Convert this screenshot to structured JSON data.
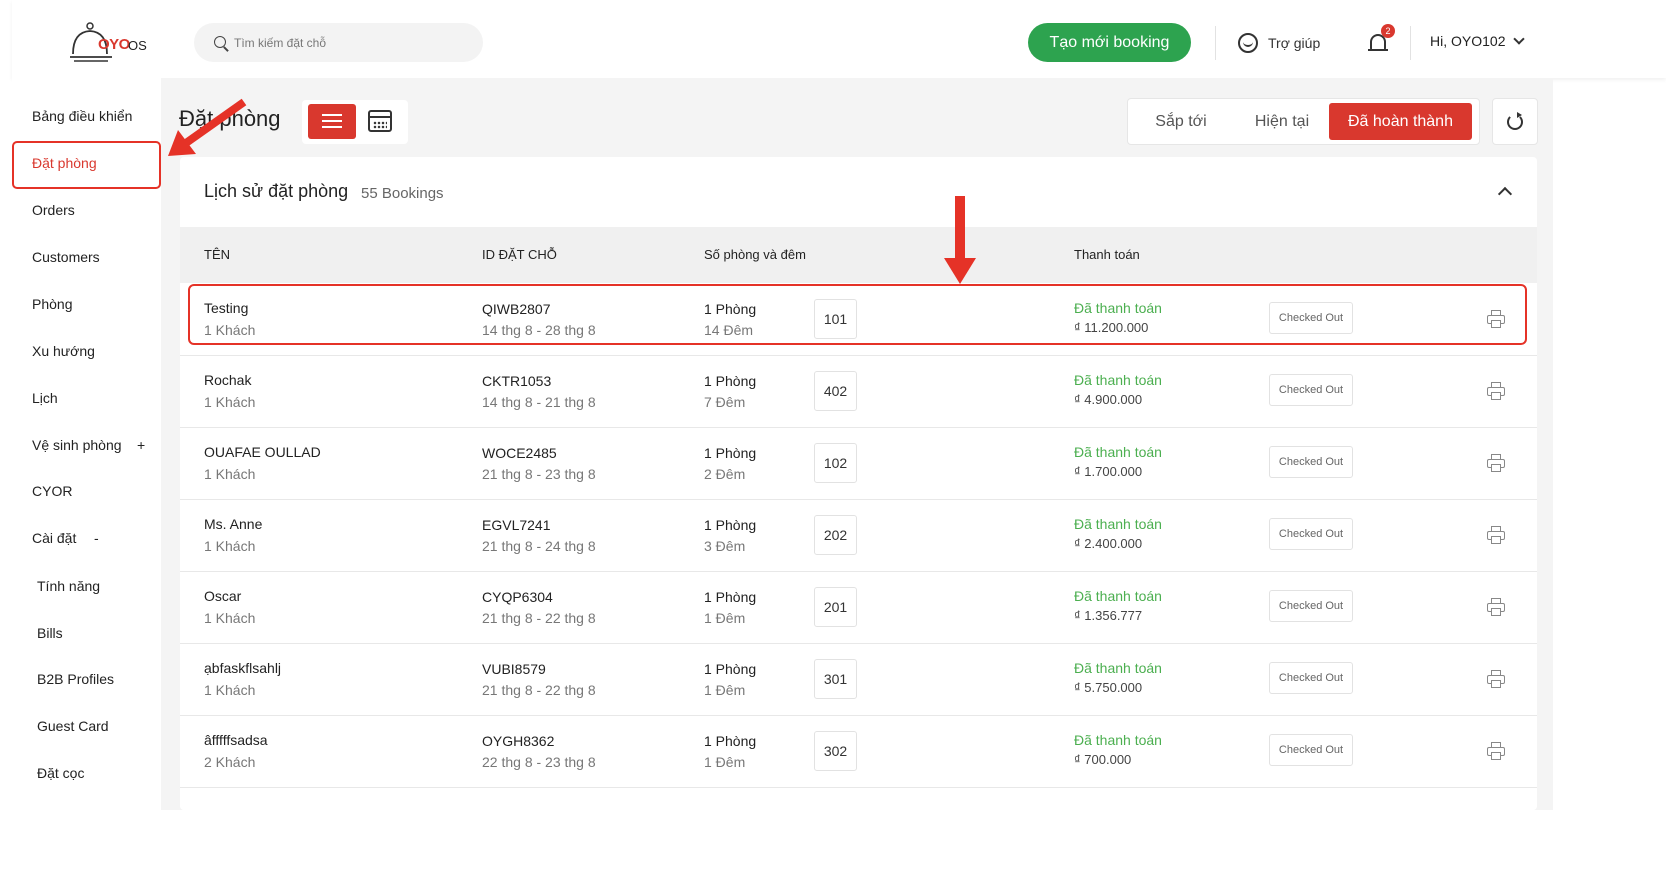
{
  "header": {
    "logo_text": "OYO",
    "logo_suffix": "OS",
    "search_placeholder": "Tìm kiếm đặt chỗ",
    "new_booking_label": "Tạo mới booking",
    "help_label": "Trợ giúp",
    "notification_count": "2",
    "user_greeting": "Hi, OYO102"
  },
  "sidebar": {
    "items": [
      {
        "label": "Bảng điều khiển"
      },
      {
        "label": "Đặt phòng"
      },
      {
        "label": "Orders"
      },
      {
        "label": "Customers"
      },
      {
        "label": "Phòng"
      },
      {
        "label": "Xu hướng"
      },
      {
        "label": "Lịch"
      },
      {
        "label": "Vệ sinh phòng"
      },
      {
        "label": "CYOR"
      },
      {
        "label": "Cài đặt"
      },
      {
        "label": "Tính năng"
      },
      {
        "label": "Bills"
      },
      {
        "label": "B2B Profiles"
      },
      {
        "label": "Guest Card"
      },
      {
        "label": "Đặt cọc"
      }
    ],
    "expand_plus": "+",
    "collapse_minus": "-"
  },
  "page": {
    "title": "Đặt phòng",
    "status_tabs": [
      "Sắp tới",
      "Hiện tại",
      "Đã hoàn thành"
    ],
    "section_title": "Lịch sử đặt phòng",
    "section_count": "55 Bookings"
  },
  "table": {
    "headers": [
      "TÊN",
      "ID ĐẶT CHỖ",
      "Số phòng và đêm",
      "Thanh toán"
    ],
    "rows": [
      {
        "name": "Testing",
        "guests": "1 Khách",
        "id": "QIWB2807",
        "dates": "14 thg 8 - 28 thg 8",
        "rooms": "1 Phòng",
        "nights": "14 Đêm",
        "room_no": "101",
        "payment": "Đã thanh toán",
        "amount": "₫ 11.200.000",
        "status": "Checked Out"
      },
      {
        "name": "Rochak",
        "guests": "1 Khách",
        "id": "CKTR1053",
        "dates": "14 thg 8 - 21 thg 8",
        "rooms": "1 Phòng",
        "nights": "7 Đêm",
        "room_no": "402",
        "payment": "Đã thanh toán",
        "amount": "₫ 4.900.000",
        "status": "Checked Out"
      },
      {
        "name": "OUAFAE OULLAD",
        "guests": "1 Khách",
        "id": "WOCE2485",
        "dates": "21 thg 8 - 23 thg 8",
        "rooms": "1 Phòng",
        "nights": "2 Đêm",
        "room_no": "102",
        "payment": "Đã thanh toán",
        "amount": "₫ 1.700.000",
        "status": "Checked Out"
      },
      {
        "name": "Ms. Anne",
        "guests": "1 Khách",
        "id": "EGVL7241",
        "dates": "21 thg 8 - 24 thg 8",
        "rooms": "1 Phòng",
        "nights": "3 Đêm",
        "room_no": "202",
        "payment": "Đã thanh toán",
        "amount": "₫ 2.400.000",
        "status": "Checked Out"
      },
      {
        "name": "Oscar",
        "guests": "1 Khách",
        "id": "CYQP6304",
        "dates": "21 thg 8 - 22 thg 8",
        "rooms": "1 Phòng",
        "nights": "1 Đêm",
        "room_no": "201",
        "payment": "Đã thanh toán",
        "amount": "₫ 1.356.777",
        "status": "Checked Out"
      },
      {
        "name": "ạbfaskflsahlj",
        "guests": "1 Khách",
        "id": "VUBI8579",
        "dates": "21 thg 8 - 22 thg 8",
        "rooms": "1 Phòng",
        "nights": "1 Đêm",
        "room_no": "301",
        "payment": "Đã thanh toán",
        "amount": "₫ 5.750.000",
        "status": "Checked Out"
      },
      {
        "name": "âfffffsadsa",
        "guests": "2 Khách",
        "id": "OYGH8362",
        "dates": "22 thg 8 - 23 thg 8",
        "rooms": "1 Phòng",
        "nights": "1 Đêm",
        "room_no": "302",
        "payment": "Đã thanh toán",
        "amount": "₫ 700.000",
        "status": "Checked Out"
      }
    ]
  },
  "colors": {
    "brand_red": "#d9382e",
    "paid_green": "#4caf50",
    "cta_green": "#2da34f",
    "annotation_red": "#e53227"
  }
}
